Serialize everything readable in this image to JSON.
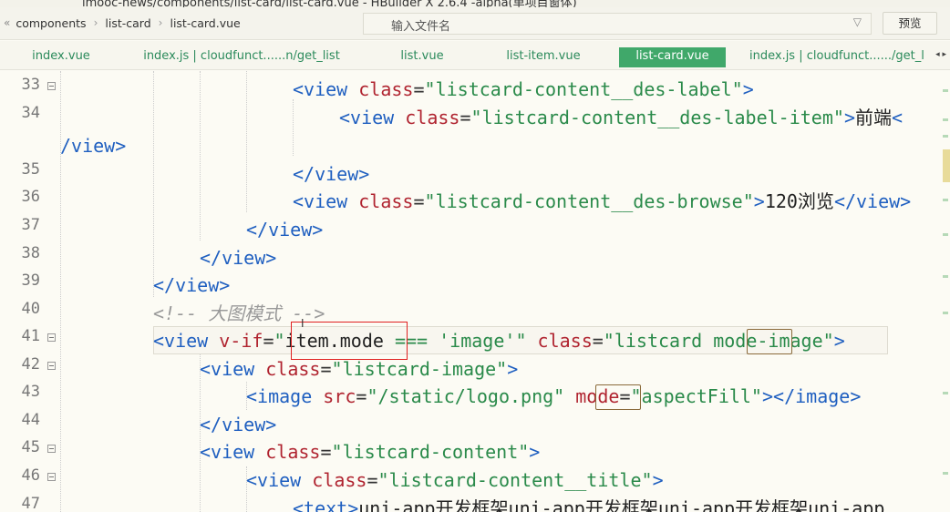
{
  "window": {
    "title": "imooc-news/components/list-card/list-card.vue - HBuilder X 2.6.4 -alpha(单项目窗体)"
  },
  "toolbar": {
    "nav_back": "«",
    "breadcrumb": [
      "components",
      "list-card",
      "list-card.vue"
    ],
    "search_placeholder": "输入文件名",
    "filter_icon": "filter-icon",
    "preview_label": "预览"
  },
  "tabs": [
    {
      "label": "index.vue",
      "active": false
    },
    {
      "label": "index.js | cloudfunct......n/get_list",
      "active": false
    },
    {
      "label": "list.vue",
      "active": false
    },
    {
      "label": "list-item.vue",
      "active": false
    },
    {
      "label": "list-card.vue",
      "active": true
    },
    {
      "label": "index.js | cloudfunct....../get_l",
      "active": false
    }
  ],
  "tab_scroll": "◂ ▸",
  "colors": {
    "accent": "#40a86a",
    "tag": "#1f5fc0",
    "attr": "#b02430",
    "string": "#2a8a4a"
  },
  "lines": [
    {
      "num": "33",
      "fold": true
    },
    {
      "num": "34",
      "fold": false
    },
    {
      "num": "",
      "fold": false
    },
    {
      "num": "35",
      "fold": false
    },
    {
      "num": "36",
      "fold": false
    },
    {
      "num": "37",
      "fold": false
    },
    {
      "num": "38",
      "fold": false
    },
    {
      "num": "39",
      "fold": false
    },
    {
      "num": "40",
      "fold": false
    },
    {
      "num": "41",
      "fold": true
    },
    {
      "num": "42",
      "fold": true
    },
    {
      "num": "43",
      "fold": false
    },
    {
      "num": "44",
      "fold": false
    },
    {
      "num": "45",
      "fold": true
    },
    {
      "num": "46",
      "fold": true
    },
    {
      "num": "47",
      "fold": false
    }
  ],
  "code": {
    "l33": {
      "open": "<view",
      "attr": "class",
      "val": "\"listcard-content__des-label\"",
      "close": ">"
    },
    "l34": {
      "open": "<view",
      "attr": "class",
      "val": "\"listcard-content__des-label-item\"",
      "close": ">",
      "text": "前端",
      "end": "<"
    },
    "l34b": {
      "end": "/view>"
    },
    "l35": {
      "end": "</view>"
    },
    "l36": {
      "open": "<view",
      "attr": "class",
      "val": "\"listcard-content__des-browse\"",
      "close": ">",
      "text": "120浏览",
      "end": "</view>"
    },
    "l37": {
      "end": "</view>"
    },
    "l38": {
      "end": "</view>"
    },
    "l39": {
      "end": "</view>"
    },
    "l40": {
      "comment": "<!-- 大图模式 -->"
    },
    "l41": {
      "open": "<view",
      "attr1": "v-if",
      "q": "\"",
      "expr1": "item",
      "dot": ".",
      "expr2": "mode",
      "op": "===",
      "lit": "'image'",
      "q2": "\"",
      "attr2": "class",
      "val": "\"listcard ",
      "val_hl": "mode",
      "val_end": "-image\"",
      "close": ">"
    },
    "l42": {
      "open": "<view",
      "attr": "class",
      "val": "\"listcard-image\"",
      "close": ">"
    },
    "l43": {
      "open": "<image",
      "attr": "src",
      "val": "\"/static/logo.png\"",
      "attr2": "mode",
      "val2": "\"aspectFill\"",
      "close": "></image>"
    },
    "l44": {
      "end": "</view>"
    },
    "l45": {
      "open": "<view",
      "attr": "class",
      "val": "\"listcard-content\"",
      "close": ">"
    },
    "l46": {
      "open": "<view",
      "attr": "class",
      "val": "\"listcard-content__title\"",
      "close": ">"
    },
    "l47": {
      "open": "<text>",
      "text": "uni-app开发框架uni-app开发框架uni-app开发框架uni-app"
    }
  }
}
